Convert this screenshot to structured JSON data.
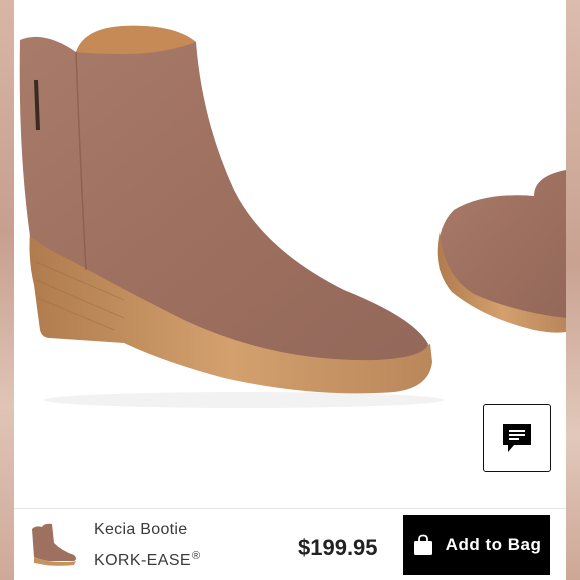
{
  "product": {
    "name": "Kecia Bootie",
    "brand": "KORK-EASE",
    "brand_mark": "®",
    "price": "$199.95"
  },
  "actions": {
    "add_to_bag_label": "Add to Bag"
  },
  "icons": {
    "chat": "chat-bubble-icon",
    "bag": "shopping-bag-icon"
  },
  "colors": {
    "suede": "#a07262",
    "sole": "#c8925f",
    "button_bg": "#000000",
    "button_text": "#ffffff"
  }
}
